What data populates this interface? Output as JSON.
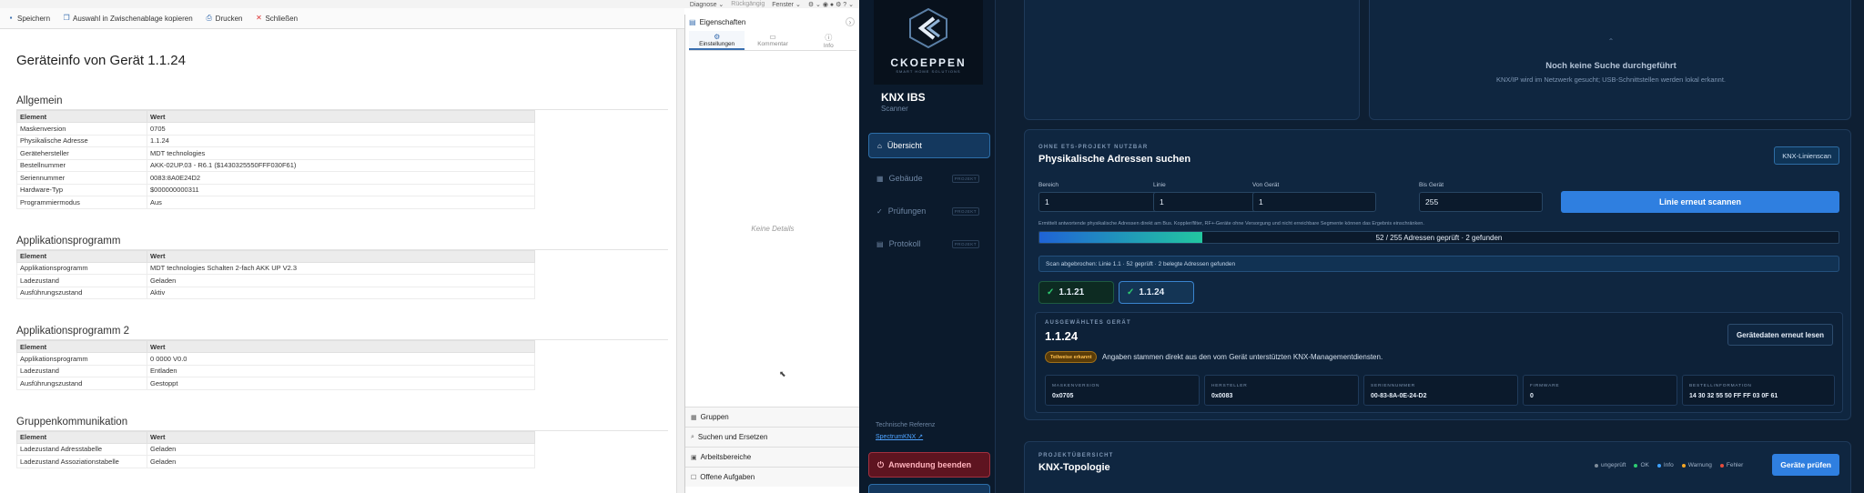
{
  "topmenu": {
    "items": [
      "Diagnose ⌄",
      "Rückgängig",
      "Fenster ⌄"
    ]
  },
  "toolbar": {
    "save": "Speichern",
    "copy": "Auswahl in Zwischenablage kopieren",
    "print": "Drucken",
    "close": "Schließen"
  },
  "document": {
    "title": "Geräteinfo von Gerät 1.1.24",
    "col_element": "Element",
    "col_value": "Wert",
    "sections": [
      {
        "title": "Allgemein",
        "rows": [
          [
            "Maskenversion",
            "0705"
          ],
          [
            "Physikalische Adresse",
            "1.1.24"
          ],
          [
            "Gerätehersteller",
            "MDT technologies"
          ],
          [
            "Bestellnummer",
            "AKK-02UP.03 - R6.1 ($1430325550FFF030F61)"
          ],
          [
            "Seriennummer",
            "0083:8A0E24D2"
          ],
          [
            "Hardware-Typ",
            "$000000000311"
          ],
          [
            "Programmiermodus",
            "Aus"
          ]
        ]
      },
      {
        "title": "Applikationsprogramm",
        "rows": [
          [
            "Applikationsprogramm",
            "MDT technologies Schalten 2-fach AKK UP V2.3"
          ],
          [
            "Ladezustand",
            "Geladen"
          ],
          [
            "Ausführungszustand",
            "Aktiv"
          ]
        ]
      },
      {
        "title": "Applikationsprogramm 2",
        "rows": [
          [
            "Applikationsprogramm",
            "0 0000 V0.0"
          ],
          [
            "Ladezustand",
            "Entladen"
          ],
          [
            "Ausführungszustand",
            "Gestoppt"
          ]
        ]
      },
      {
        "title": "Gruppenkommunikation",
        "rows": [
          [
            "Ladezustand Adresstabelle",
            "Geladen"
          ],
          [
            "Ladezustand Assoziationstabelle",
            "Geladen"
          ]
        ]
      }
    ]
  },
  "properties": {
    "title": "Eigenschaften",
    "tabs": [
      "Einstellungen",
      "Kommentar",
      "Info"
    ],
    "empty": "Keine Details",
    "bottom_items": [
      "Gruppen",
      "Suchen und Ersetzen",
      "Arbeitsbereiche",
      "Offene Aufgaben"
    ]
  },
  "sidebar": {
    "logo_text": "CKOEPPEN",
    "logo_sub": "SMART HOME SOLUTIONS",
    "app_title": "KNX IBS",
    "app_sub": "Scanner",
    "nav": [
      {
        "label": "Übersicht",
        "badge": ""
      },
      {
        "label": "Gebäude",
        "badge": "PROJEKT"
      },
      {
        "label": "Prüfungen",
        "badge": "PROJEKT"
      },
      {
        "label": "Protokoll",
        "badge": "PROJEKT"
      }
    ],
    "tech_ref": "Technische Referenz",
    "tech_link": "SpectrumKNX ↗",
    "quit": "Anwendung beenden"
  },
  "nosearch": {
    "title": "Noch keine Suche durchgeführt",
    "desc": "KNX/IP wird im Netzwerk gesucht; USB-Schnittstellen werden lokal erkannt."
  },
  "scan": {
    "caption": "OHNE ETS-PROJEKT NUTZBAR",
    "title": "Physikalische Adressen suchen",
    "line_scan_button": "KNX-Linienscan",
    "labels": [
      "Bereich",
      "Linie",
      "Von Gerät",
      "Bis Gerät"
    ],
    "values": [
      "1",
      "1",
      "1",
      "255"
    ],
    "rescan_button": "Linie erneut scannen",
    "hint": "Ermittelt antwortende physikalische Adressen direkt am Bus. Koppler/filter, RF+-Geräte ohne Versorgung und nicht erreichbare Segmente können das Ergebnis einschränken.",
    "progress_text": "52 / 255 Adressen geprüft · 2 gefunden",
    "progress": 0.204,
    "status": "Scan abgebrochen: Linie 1.1 · 52 geprüft · 2 belegte Adressen gefunden",
    "found": [
      "1.1.21",
      "1.1.24"
    ],
    "selected_caption": "AUSGEWÄHLTES GERÄT",
    "selected_address": "1.1.24",
    "reread_button": "Gerätedaten erneut lesen",
    "partial_badge": "Teilweise erkannt",
    "partial_text": "Angaben stammen direkt aus den vom Gerät unterstützten KNX-Managementdiensten.",
    "info": [
      {
        "key": "MASKENVERSION",
        "value": "0x0705"
      },
      {
        "key": "HERSTELLER",
        "value": "0x0083"
      },
      {
        "key": "SERIENNUMMER",
        "value": "00-83-8A-0E-24-D2"
      },
      {
        "key": "FIRMWARE",
        "value": "0"
      },
      {
        "key": "BESTELLINFORMATION",
        "value": "14 30 32 55 50 FF FF 03 0F 61"
      }
    ]
  },
  "topology": {
    "caption": "PROJEKTÜBERSICHT",
    "title": "KNX-Topologie",
    "legend": [
      {
        "label": "ungeprüft",
        "color": "#7f8c9b"
      },
      {
        "label": "OK",
        "color": "#2ecc71"
      },
      {
        "label": "Info",
        "color": "#3ea2ff"
      },
      {
        "label": "Warnung",
        "color": "#f5a623"
      },
      {
        "label": "Fehler",
        "color": "#e74c3c"
      }
    ],
    "check_button": "Geräte prüfen"
  },
  "colors": {
    "accent": "#2f7fe0",
    "progress_start": "#1f63d6",
    "progress_end": "#22c7a0",
    "ok": "#2ecc71",
    "badge_bg": "#5a3c08",
    "badge_fg": "#ffbf4d"
  }
}
